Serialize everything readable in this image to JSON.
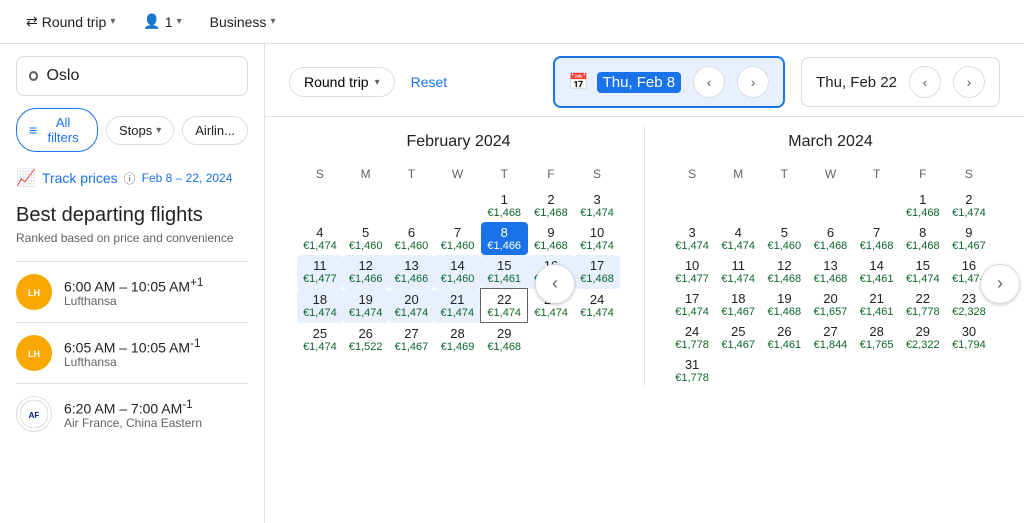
{
  "topbar": {
    "roundtrip_label": "Round trip",
    "passengers_label": "1",
    "class_label": "Business"
  },
  "left": {
    "search_placeholder": "Oslo",
    "filters": {
      "all_label": "All filters",
      "stops_label": "Stops",
      "airlines_label": "Airlin..."
    },
    "track_prices_label": "Track prices",
    "track_prices_info": "ⓘ",
    "date_range": "Feb 8 – 22, 2024",
    "best_flights_title": "Best departing flights",
    "best_flights_sub": "Ranked based on price and convenience",
    "flights": [
      {
        "time": "6:00 AM – 10:05 AM",
        "superscript": "+1",
        "airline": "Lufthansa",
        "type": "lh"
      },
      {
        "time": "6:05 AM – 10:05 AM",
        "superscript": "-1",
        "airline": "Lufthansa",
        "type": "lh"
      },
      {
        "time": "6:20 AM – 7:00 AM",
        "superscript": "-1",
        "airline": "Air France, China Eastern",
        "type": "af"
      }
    ]
  },
  "calendar": {
    "round_trip_label": "Round trip",
    "reset_label": "Reset",
    "date_from": "Thu, Feb 8",
    "date_to": "Thu, Feb 22",
    "feb": {
      "title": "February 2024",
      "days_header": [
        "S",
        "M",
        "T",
        "W",
        "T",
        "F",
        "S"
      ],
      "weeks": [
        [
          {
            "day": "",
            "price": ""
          },
          {
            "day": "",
            "price": ""
          },
          {
            "day": "",
            "price": ""
          },
          {
            "day": "",
            "price": ""
          },
          {
            "day": "1",
            "price": "€1,468"
          },
          {
            "day": "2",
            "price": "€1,468"
          },
          {
            "day": "3",
            "price": "€1,474"
          }
        ],
        [
          {
            "day": "4",
            "price": "€1,474"
          },
          {
            "day": "5",
            "price": "€1,460"
          },
          {
            "day": "6",
            "price": "€1,460"
          },
          {
            "day": "7",
            "price": "€1,460"
          },
          {
            "day": "8",
            "price": "€1,466",
            "selected": true
          },
          {
            "day": "9",
            "price": "€1,468"
          },
          {
            "day": "10",
            "price": "€1,474"
          }
        ],
        [
          {
            "day": "11",
            "price": "€1,477",
            "range": true
          },
          {
            "day": "12",
            "price": "€1,466",
            "range": true
          },
          {
            "day": "13",
            "price": "€1,466",
            "range": true
          },
          {
            "day": "14",
            "price": "€1,460",
            "range": true
          },
          {
            "day": "15",
            "price": "€1,461",
            "range": true
          },
          {
            "day": "16",
            "price": "€1,474",
            "range": true
          },
          {
            "day": "17",
            "price": "€1,468",
            "range": true
          }
        ],
        [
          {
            "day": "18",
            "price": "€1,474",
            "range": true
          },
          {
            "day": "19",
            "price": "€1,474",
            "range": true
          },
          {
            "day": "20",
            "price": "€1,474",
            "range": true
          },
          {
            "day": "21",
            "price": "€1,474",
            "range": true
          },
          {
            "day": "22",
            "price": "€1,474",
            "end_selected": true
          },
          {
            "day": "23",
            "price": "€1,474"
          },
          {
            "day": "24",
            "price": "€1,474"
          }
        ],
        [
          {
            "day": "25",
            "price": "€1,474"
          },
          {
            "day": "26",
            "price": "€1,522"
          },
          {
            "day": "27",
            "price": "€1,467"
          },
          {
            "day": "28",
            "price": "€1,469"
          },
          {
            "day": "29",
            "price": "€1,468"
          },
          {
            "day": "",
            "price": ""
          },
          {
            "day": "",
            "price": ""
          }
        ]
      ]
    },
    "mar": {
      "title": "March 2024",
      "days_header": [
        "S",
        "M",
        "T",
        "W",
        "T",
        "F",
        "S"
      ],
      "weeks": [
        [
          {
            "day": "",
            "price": ""
          },
          {
            "day": "",
            "price": ""
          },
          {
            "day": "",
            "price": ""
          },
          {
            "day": "",
            "price": ""
          },
          {
            "day": "",
            "price": ""
          },
          {
            "day": "1",
            "price": "€1,468"
          },
          {
            "day": "2",
            "price": "€1,474"
          }
        ],
        [
          {
            "day": "3",
            "price": "€1,474"
          },
          {
            "day": "4",
            "price": "€1,474"
          },
          {
            "day": "5",
            "price": "€1,460"
          },
          {
            "day": "6",
            "price": "€1,468"
          },
          {
            "day": "7",
            "price": "€1,468"
          },
          {
            "day": "8",
            "price": "€1,468"
          },
          {
            "day": "9",
            "price": "€1,467"
          }
        ],
        [
          {
            "day": "10",
            "price": "€1,477"
          },
          {
            "day": "11",
            "price": "€1,474"
          },
          {
            "day": "12",
            "price": "€1,468"
          },
          {
            "day": "13",
            "price": "€1,468"
          },
          {
            "day": "14",
            "price": "€1,461"
          },
          {
            "day": "15",
            "price": "€1,474"
          },
          {
            "day": "16",
            "price": "€1,474"
          }
        ],
        [
          {
            "day": "17",
            "price": "€1,474"
          },
          {
            "day": "18",
            "price": "€1,467"
          },
          {
            "day": "19",
            "price": "€1,468"
          },
          {
            "day": "20",
            "price": "€1,657"
          },
          {
            "day": "21",
            "price": "€1,461"
          },
          {
            "day": "22",
            "price": "€1,778"
          },
          {
            "day": "23",
            "price": "€2,328"
          }
        ],
        [
          {
            "day": "24",
            "price": "€1,778"
          },
          {
            "day": "25",
            "price": "€1,467"
          },
          {
            "day": "26",
            "price": "€1,461"
          },
          {
            "day": "27",
            "price": "€1,844"
          },
          {
            "day": "28",
            "price": "€1,765"
          },
          {
            "day": "29",
            "price": "€2,322"
          },
          {
            "day": "30",
            "price": "€1,794"
          }
        ],
        [
          {
            "day": "31",
            "price": "€1,778"
          },
          {
            "day": "",
            "price": ""
          },
          {
            "day": "",
            "price": ""
          },
          {
            "day": "",
            "price": ""
          },
          {
            "day": "",
            "price": ""
          },
          {
            "day": "",
            "price": ""
          },
          {
            "day": "",
            "price": ""
          }
        ]
      ]
    }
  }
}
